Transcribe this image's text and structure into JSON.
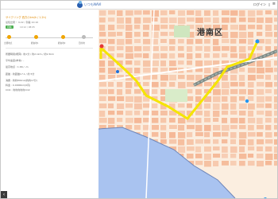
{
  "header": {
    "logo_text": "いつもNAVI",
    "login_label": "ログイン",
    "login_icon": "door-icon",
    "menu_icon": "hamburger-icon"
  },
  "route": {
    "title": "サイクリング 西方(1km/h / 1.2h)",
    "depart_arrive": "最短出発・ 9:22 / 到着 10:10",
    "badge": "有料",
    "badge_note": "10:12 / 08:05",
    "steps": [
      {
        "label": "出発地点",
        "color": "#f0a500"
      },
      {
        "label": "経由地1",
        "color": "#f0a500"
      },
      {
        "label": "経由地2",
        "color": "#f0a500"
      },
      {
        "label": "目的地",
        "color": "#bbbbbb"
      }
    ],
    "info_lines": [
      "所要時間(概算): 約1分 / 約2.1km / 約1.5km",
      "平均速度(参考): -",
      "最高地点 : 1.66 / -m",
      "距離 : 約距離17.1 / 約 5分",
      "消費 : 約約80kcal(約約17分)",
      "料金 : 0.0000km(0円)",
      "CO2 : 約約約約約CO2"
    ]
  },
  "map": {
    "district_label": "港南区",
    "route_color": "#f5e500",
    "land_color": "#fbeee0",
    "block_color": "#f4b592",
    "sea_color": "#a9c3f0",
    "rail_color": "#7d8a86"
  },
  "collapse_icon": "chevron-left-icon",
  "collapse_glyph": "‹"
}
